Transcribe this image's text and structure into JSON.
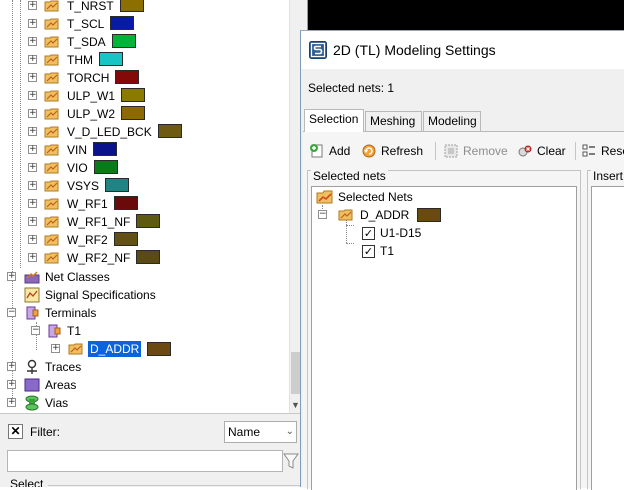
{
  "tree": {
    "nets": [
      {
        "label": "T_NRST",
        "color": "#8c6f00"
      },
      {
        "label": "T_SCL",
        "color": "#0a1aa8"
      },
      {
        "label": "T_SDA",
        "color": "#00b43a"
      },
      {
        "label": "THM",
        "color": "#18c4c4"
      },
      {
        "label": "TORCH",
        "color": "#840a0a"
      },
      {
        "label": "ULP_W1",
        "color": "#8a7a00"
      },
      {
        "label": "ULP_W2",
        "color": "#8c6a00"
      },
      {
        "label": "V_D_LED_BCK",
        "color": "#6e5a12"
      },
      {
        "label": "VIN",
        "color": "#0a138c"
      },
      {
        "label": "VIO",
        "color": "#0a7a1a"
      },
      {
        "label": "VSYS",
        "color": "#1f8484"
      },
      {
        "label": "W_RF1",
        "color": "#6a0a0a"
      },
      {
        "label": "W_RF1_NF",
        "color": "#5e5a12"
      },
      {
        "label": "W_RF2",
        "color": "#625016"
      },
      {
        "label": "W_RF2_NF",
        "color": "#5a4a16"
      }
    ],
    "net_classes": "Net Classes",
    "signal_specifications": "Signal Specifications",
    "terminals": "Terminals",
    "terminal_t1": "T1",
    "terminal_net": {
      "label": "D_ADDR",
      "color": "#6b4a12"
    },
    "traces": "Traces",
    "areas": "Areas",
    "vias": "Vias"
  },
  "filter": {
    "label": "Filter:",
    "mode": "Name",
    "value": "",
    "select_label": "Select"
  },
  "dialog": {
    "title": "2D (TL) Modeling Settings",
    "selected_nets_count": "Selected nets: 1",
    "tabs": [
      {
        "label": "Selection",
        "active": true
      },
      {
        "label": "Meshing",
        "active": false
      },
      {
        "label": "Modeling",
        "active": false
      }
    ],
    "toolbar": {
      "add": "Add",
      "refresh": "Refresh",
      "remove": "Remove",
      "clear": "Clear",
      "reset": "Rese"
    },
    "selected_nets_group": "Selected nets",
    "insert_group": "Insert",
    "tree": {
      "root": "Selected Nets",
      "net": {
        "label": "D_ADDR",
        "color": "#6b4a12"
      },
      "children": [
        {
          "label": "U1-D15",
          "checked": true
        },
        {
          "label": "T1",
          "checked": true
        }
      ]
    }
  }
}
